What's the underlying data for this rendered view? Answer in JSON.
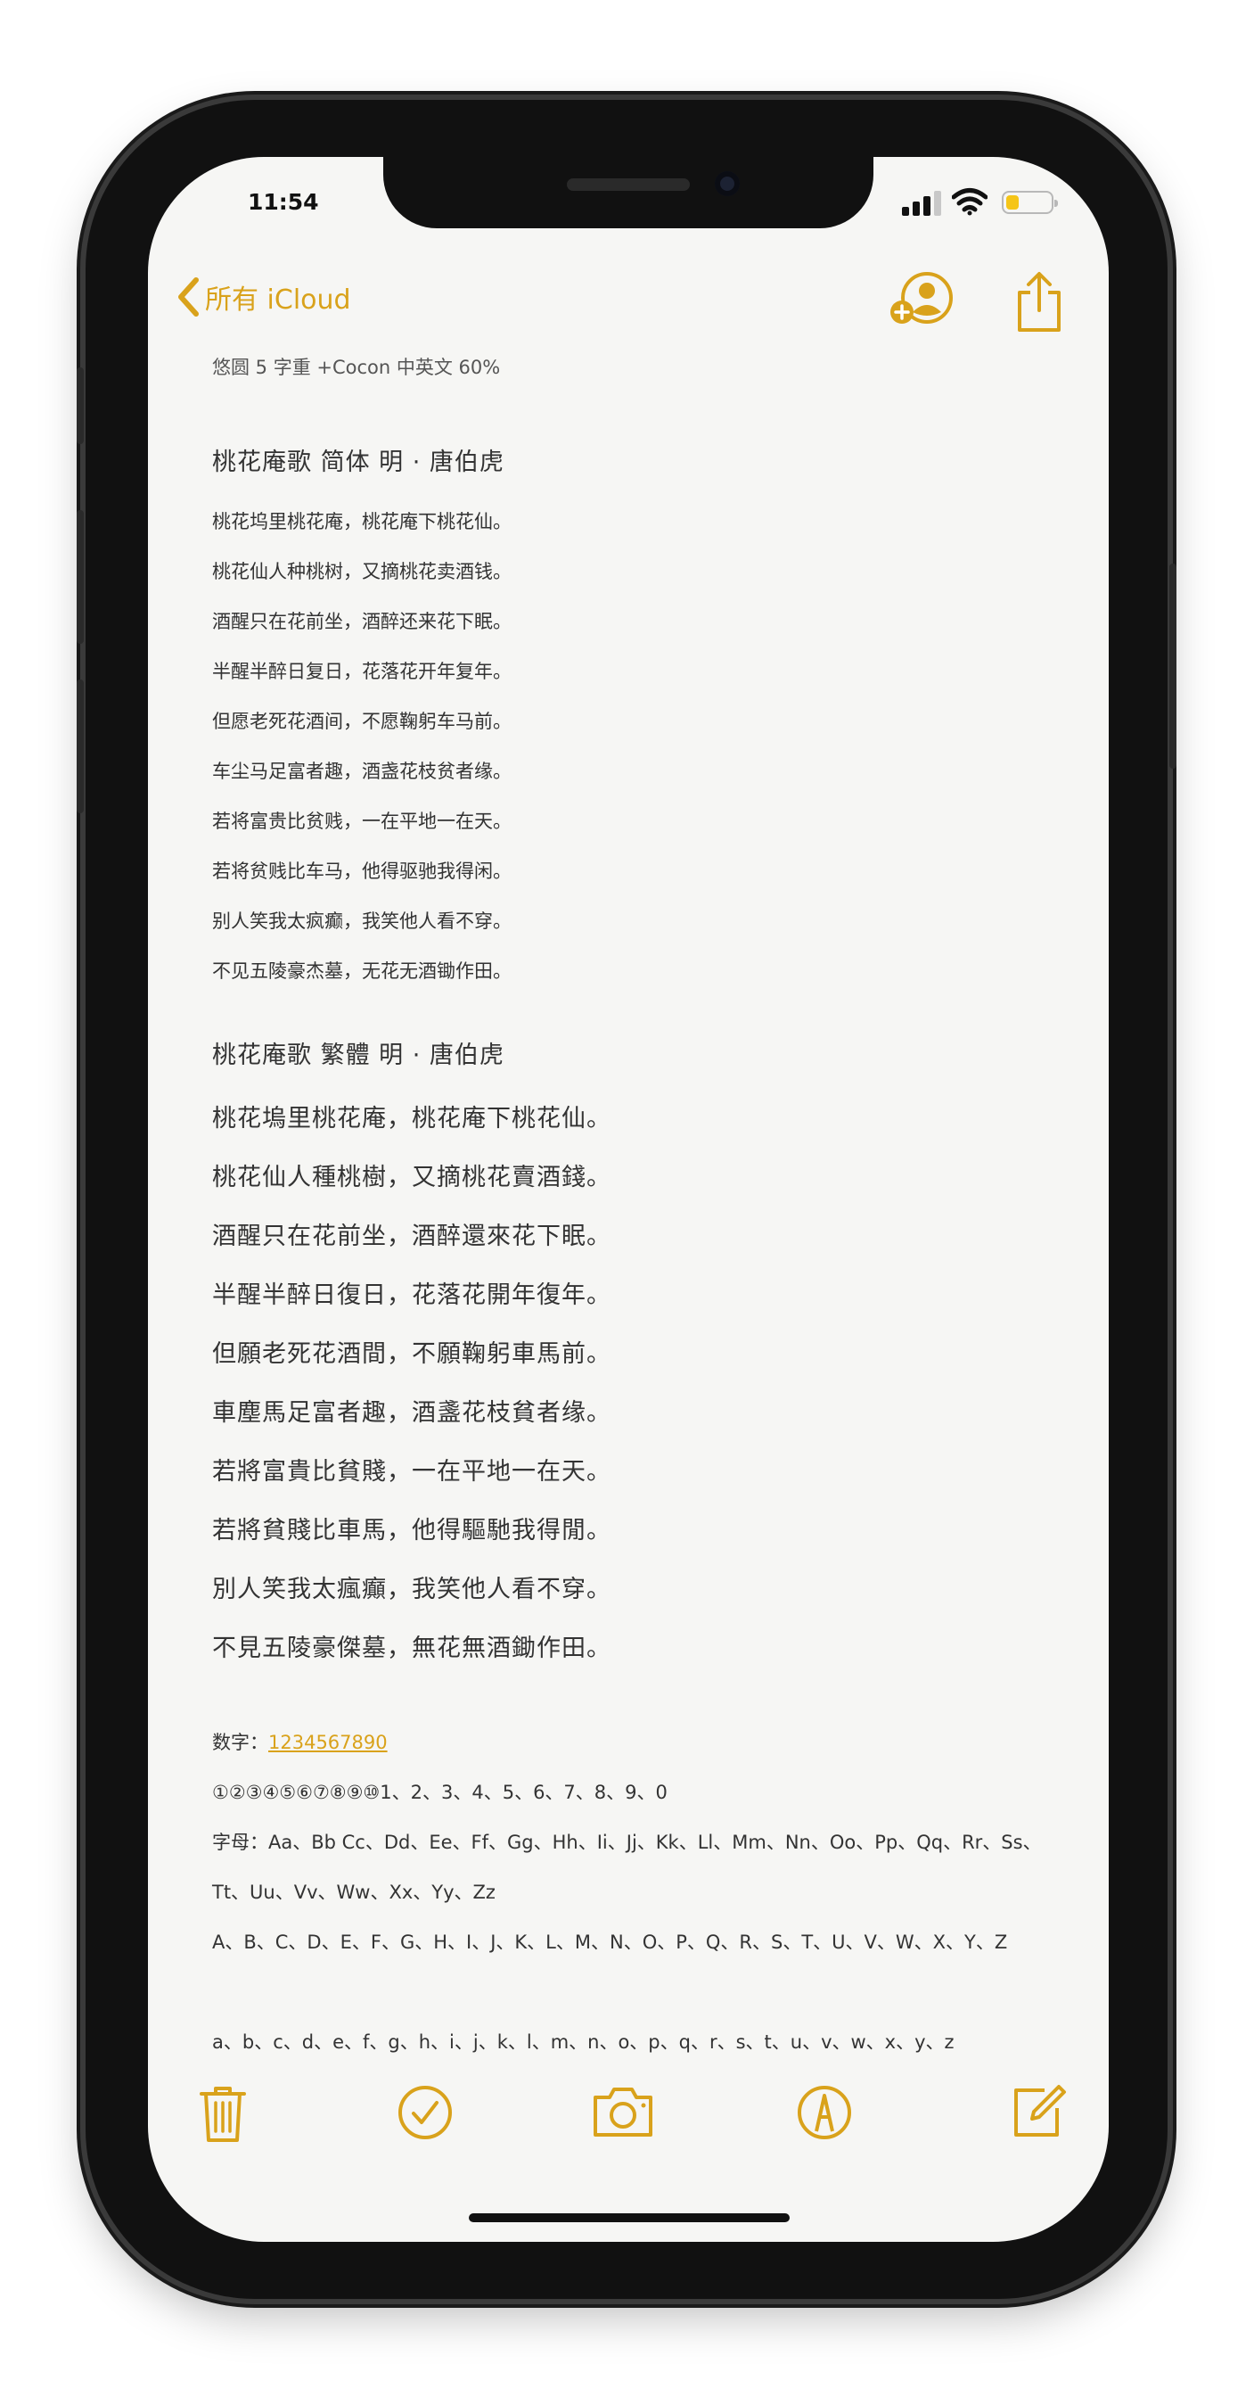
{
  "status": {
    "time": "11:54"
  },
  "nav": {
    "back_label": "所有 iCloud"
  },
  "note": {
    "subtitle": "悠圆 5 字重 +Cocon 中英文 60%",
    "simplified": {
      "title": "桃花庵歌 简体  明 · 唐伯虎",
      "lines": [
        "桃花坞里桃花庵，桃花庵下桃花仙。",
        "桃花仙人种桃树，又摘桃花卖酒钱。",
        "酒醒只在花前坐，酒醉还来花下眠。",
        "半醒半醉日复日，花落花开年复年。",
        "但愿老死花酒间，不愿鞠躬车马前。",
        "车尘马足富者趣，酒盏花枝贫者缘。",
        "若将富贵比贫贱，一在平地一在天。",
        "若将贫贱比车马，他得驱驰我得闲。",
        "别人笑我太疯癫，我笑他人看不穿。",
        "不见五陵豪杰墓，无花无酒锄作田。"
      ]
    },
    "traditional": {
      "title": "桃花庵歌 繁體   明 · 唐伯虎",
      "lines": [
        "桃花塢里桃花庵，桃花庵下桃花仙。",
        "桃花仙人種桃樹，又摘桃花賣酒錢。",
        "酒醒只在花前坐，酒醉還來花下眠。",
        "半醒半醉日復日，花落花開年復年。",
        "但願老死花酒間，不願鞠躬車馬前。",
        "車塵馬足富者趣，酒盞花枝貧者缘。",
        "若將富貴比貧賤，一在平地一在天。",
        "若將貧賤比車馬，他得驅馳我得閒。",
        "別人笑我太瘋癲，我笑他人看不穿。",
        "不見五陵豪傑墓，無花無酒鋤作田。"
      ]
    },
    "numbers_label": "数字：",
    "numbers_link": "1234567890",
    "circled_numbers": "①②③④⑤⑥⑦⑧⑨⑩1、2、3、4、5、6、7、8、9、0",
    "letters_line1": "字母：Aa、Bb Cc、Dd、Ee、Ff、Gg、Hh、Ii、Jj、Kk、Ll、Mm、Nn、Oo、Pp、Qq、Rr、Ss、",
    "letters_line2": "Tt、Uu、Vv、Ww、Xx、Yy、Zz",
    "uppercase": "A、B、C、D、E、F、G、H、I、J、K、L、M、N、O、P、Q、R、S、T、U、V、W、X、Y、Z",
    "lowercase": "a、b、c、d、e、f、g、h、i、j、k、l、m、n、o、p、q、r、s、t、u、v、w、x、y、z"
  },
  "colors": {
    "accent": "#d9a21b",
    "background": "#f6f6f4"
  },
  "icons": [
    "chevron-left-icon",
    "add-person-icon",
    "share-icon",
    "trash-icon",
    "checkmark-circle-icon",
    "camera-icon",
    "markup-pen-icon",
    "compose-icon"
  ]
}
